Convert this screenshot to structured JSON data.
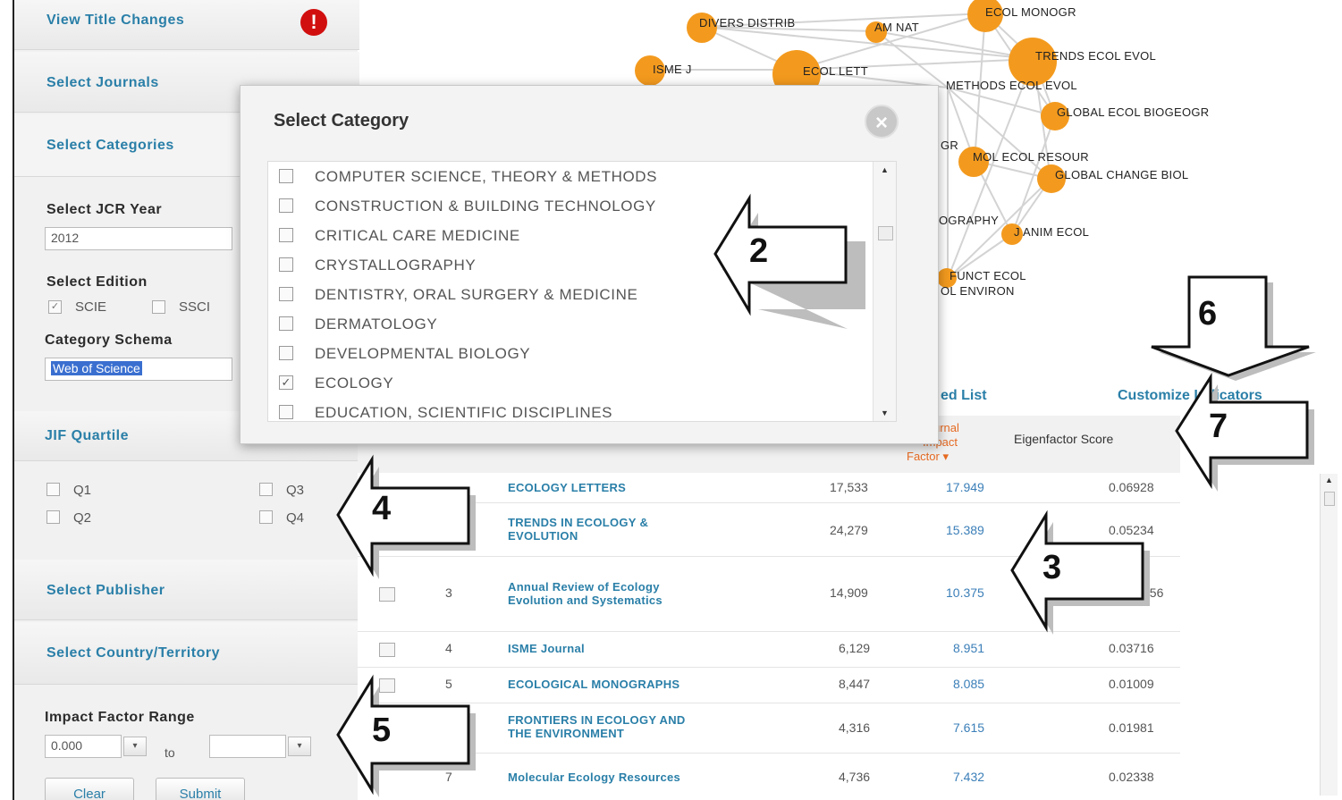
{
  "sidebar": {
    "view_title_changes": "View Title Changes",
    "warning_glyph": "!",
    "select_journals": "Select Journals",
    "select_categories": "Select Categories",
    "jcr_year_label": "Select JCR Year",
    "jcr_year_value": "2012",
    "edition_label": "Select Edition",
    "edition_scie": "SCIE",
    "edition_ssci": "SSCI",
    "schema_label": "Category Schema",
    "schema_value": "Web of Science",
    "jif_quartile": "JIF Quartile",
    "quartiles": [
      "Q1",
      "Q2",
      "Q3",
      "Q4"
    ],
    "select_publisher": "Select Publisher",
    "select_country": "Select Country/Territory",
    "impact_range_label": "Impact Factor Range",
    "impact_min": "0.000",
    "impact_to": "to",
    "impact_max": "",
    "clear_button": "Clear",
    "submit_button": "Submit"
  },
  "graph": {
    "node_color": "#f39a1e",
    "nodes": [
      "DIVERS DISTRIB",
      "AM NAT",
      "ECOL MONOGR",
      "ISME J",
      "ECOL LETT",
      "TRENDS ECOL EVOL",
      "METHODS ECOL EVOL",
      "GLOBAL ECOL BIOGEOGR",
      "MOL ECOL RESOUR",
      "GLOBAL CHANGE BIOL",
      "J ANIM ECOL",
      "FUNCT ECOL",
      "OL ENVIRON",
      "OGRAPHY",
      "GR"
    ]
  },
  "tabs": {
    "ranked_list": "ed List",
    "customize_indicators": "Customize Indicators"
  },
  "table": {
    "headers": {
      "jif_line1": "urnal",
      "jif_line2": "Impact",
      "jif_line3": "Factor ▾",
      "eigenfactor": "Eigenfactor Score"
    },
    "rows": [
      {
        "rank": "",
        "title": "ECOLOGY LETTERS",
        "title2": "",
        "cites": "17,533",
        "jif": "17.949",
        "eigen": "0.06928"
      },
      {
        "rank": "",
        "title": "TRENDS IN ECOLOGY &",
        "title2": "EVOLUTION",
        "cites": "24,279",
        "jif": "15.389",
        "eigen": "0.05234"
      },
      {
        "rank": "3",
        "title": "Annual Review of Ecology",
        "title2": "Evolution and Systematics",
        "cites": "14,909",
        "jif": "10.375",
        "eigen": "556"
      },
      {
        "rank": "4",
        "title": "ISME Journal",
        "title2": "",
        "cites": "6,129",
        "jif": "8.951",
        "eigen": "0.03716"
      },
      {
        "rank": "5",
        "title": "ECOLOGICAL MONOGRAPHS",
        "title2": "",
        "cites": "8,447",
        "jif": "8.085",
        "eigen": "0.01009"
      },
      {
        "rank": "",
        "title": "FRONTIERS IN ECOLOGY AND",
        "title2": "THE ENVIRONMENT",
        "cites": "4,316",
        "jif": "7.615",
        "eigen": "0.01981"
      },
      {
        "rank": "7",
        "title": "Molecular Ecology Resources",
        "title2": "",
        "cites": "4,736",
        "jif": "7.432",
        "eigen": "0.02338"
      }
    ]
  },
  "modal": {
    "title": "Select Category",
    "close_glyph": "×",
    "categories": [
      {
        "label": "COMPUTER SCIENCE, THEORY & METHODS",
        "checked": false
      },
      {
        "label": "CONSTRUCTION & BUILDING TECHNOLOGY",
        "checked": false
      },
      {
        "label": "CRITICAL CARE MEDICINE",
        "checked": false
      },
      {
        "label": "CRYSTALLOGRAPHY",
        "checked": false
      },
      {
        "label": "DENTISTRY, ORAL SURGERY & MEDICINE",
        "checked": false
      },
      {
        "label": "DERMATOLOGY",
        "checked": false
      },
      {
        "label": "DEVELOPMENTAL BIOLOGY",
        "checked": false
      },
      {
        "label": "ECOLOGY",
        "checked": true
      },
      {
        "label": "EDUCATION, SCIENTIFIC DISCIPLINES",
        "checked": false
      }
    ]
  },
  "callouts": [
    "2",
    "3",
    "4",
    "5",
    "6",
    "7"
  ]
}
